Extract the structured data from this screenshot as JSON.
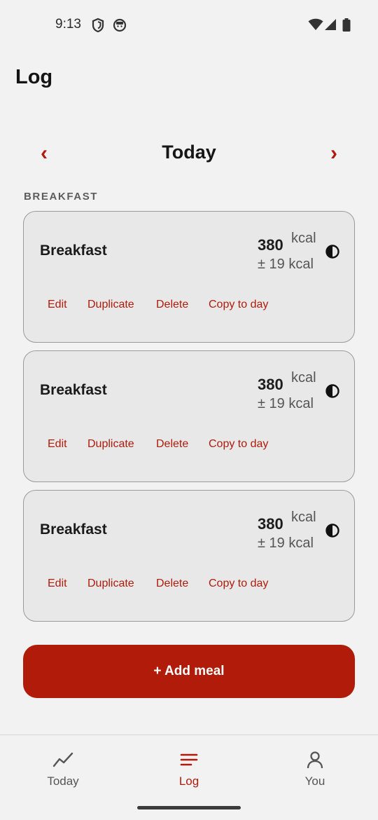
{
  "status_bar": {
    "time": "9:13",
    "icons": [
      "shield-icon",
      "face-icon",
      "wifi-icon",
      "signal-icon",
      "battery-icon"
    ]
  },
  "header": {
    "title": "Log"
  },
  "day_nav": {
    "title": "Today",
    "prev": "‹",
    "next": "›"
  },
  "section": {
    "label": "BREAKFAST"
  },
  "meals": [
    {
      "name": "Breakfast",
      "kcal": "380",
      "unit": "kcal",
      "range": "± 19 kcal",
      "actions": {
        "edit": "Edit",
        "duplicate": "Duplicate",
        "delete": "Delete",
        "copy": "Copy to day"
      }
    },
    {
      "name": "Breakfast",
      "kcal": "380",
      "unit": "kcal",
      "range": "± 19 kcal",
      "actions": {
        "edit": "Edit",
        "duplicate": "Duplicate",
        "delete": "Delete",
        "copy": "Copy to day"
      }
    },
    {
      "name": "Breakfast",
      "kcal": "380",
      "unit": "kcal",
      "range": "± 19 kcal",
      "actions": {
        "edit": "Edit",
        "duplicate": "Duplicate",
        "delete": "Delete",
        "copy": "Copy to day"
      }
    }
  ],
  "add_meal": {
    "label": "+ Add meal"
  },
  "bottom_nav": {
    "items": [
      {
        "label": "Today",
        "icon": "trend-chart-icon",
        "active": false
      },
      {
        "label": "Log",
        "icon": "menu-lines-icon",
        "active": true
      },
      {
        "label": "You",
        "icon": "person-icon",
        "active": false
      }
    ]
  },
  "colors": {
    "accent": "#b01b0a",
    "background": "#f2f2f2",
    "card": "#e8e8e8"
  }
}
